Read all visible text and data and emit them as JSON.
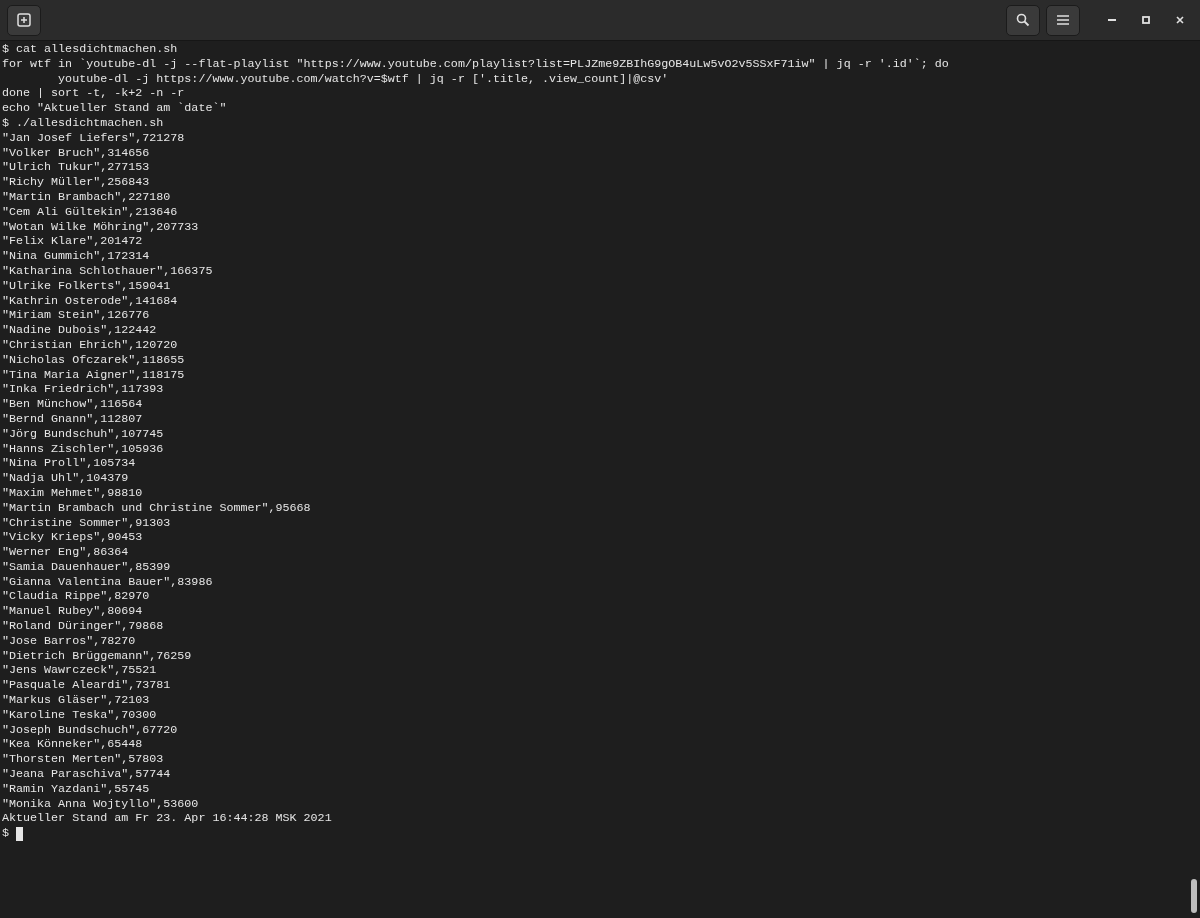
{
  "terminal": {
    "lines": [
      "$ cat allesdichtmachen.sh",
      "for wtf in `youtube-dl -j --flat-playlist \"https://www.youtube.com/playlist?list=PLJZme9ZBIhG9gOB4uLw5vO2v5SSxF71iw\" | jq -r '.id'`; do",
      "        youtube-dl -j https://www.youtube.com/watch?v=$wtf | jq -r ['.title, .view_count]|@csv'",
      "done | sort -t, -k+2 -n -r",
      "echo \"Aktueller Stand am `date`\"",
      "$ ./allesdichtmachen.sh",
      "\"Jan Josef Liefers\",721278",
      "\"Volker Bruch\",314656",
      "\"Ulrich Tukur\",277153",
      "\"Richy Müller\",256843",
      "\"Martin Brambach\",227180",
      "\"Cem Ali Gültekin\",213646",
      "\"Wotan Wilke Möhring\",207733",
      "\"Felix Klare\",201472",
      "\"Nina Gummich\",172314",
      "\"Katharina Schlothauer\",166375",
      "\"Ulrike Folkerts\",159041",
      "\"Kathrin Osterode\",141684",
      "\"Miriam Stein\",126776",
      "\"Nadine Dubois\",122442",
      "\"Christian Ehrich\",120720",
      "\"Nicholas Ofczarek\",118655",
      "\"Tina Maria Aigner\",118175",
      "\"Inka Friedrich\",117393",
      "\"Ben Münchow\",116564",
      "\"Bernd Gnann\",112807",
      "\"Jörg Bundschuh\",107745",
      "\"Hanns Zischler\",105936",
      "\"Nina Proll\",105734",
      "\"Nadja Uhl\",104379",
      "\"Maxim Mehmet\",98810",
      "\"Martin Brambach und Christine Sommer\",95668",
      "\"Christine Sommer\",91303",
      "\"Vicky Krieps\",90453",
      "\"Werner Eng\",86364",
      "\"Samia Dauenhauer\",85399",
      "\"Gianna Valentina Bauer\",83986",
      "\"Claudia Rippe\",82970",
      "\"Manuel Rubey\",80694",
      "\"Roland Düringer\",79868",
      "\"Jose Barros\",78270",
      "\"Dietrich Brüggemann\",76259",
      "\"Jens Wawrczeck\",75521",
      "\"Pasquale Aleardi\",73781",
      "\"Markus Gläser\",72103",
      "\"Karoline Teska\",70300",
      "\"Joseph Bundschuch\",67720",
      "\"Kea Könneker\",65448",
      "\"Thorsten Merten\",57803",
      "\"Jeana Paraschiva\",57744",
      "\"Ramin Yazdani\",55745",
      "\"Monika Anna Wojtyllo\",53600",
      "Aktueller Stand am Fr 23. Apr 16:44:28 MSK 2021"
    ],
    "prompt": "$"
  }
}
